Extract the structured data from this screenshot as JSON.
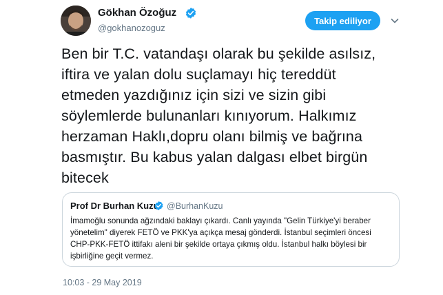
{
  "author": {
    "name": "Gökhan Özoğuz",
    "handle": "@gokhanozoguz",
    "verified": true
  },
  "follow_button": {
    "label": "Takip ediliyor"
  },
  "tweet": {
    "text": "Ben bir T.C. vatandaşı olarak bu şekilde asılsız,\niftira ve yalan dolu suçlamayı hiç tereddüt\netmeden yazdığınız için sizi ve sizin gibi\nsöylemlerde bulunanları kınıyorum. Halkımız\nherzaman Haklı,dopru olanı bilmiş ve bağrına\nbasmıştır. Bu kabus yalan dalgası elbet birgün\nbitecek",
    "timestamp": "10:03 - 29 May 2019"
  },
  "quoted_tweet": {
    "author_name": "Prof Dr Burhan Kuzu",
    "author_handle": "@BurhanKuzu",
    "verified": true,
    "text": "İmamoğlu sonunda ağzındaki baklayı çıkardı. Canlı yayında \"Gelin Türkiye'yi beraber\nyönetelim\" diyerek FETÖ ve PKK'ya açıkça mesaj gönderdi. İstanbul seçimleri öncesi\nCHP-PKK-FETÖ ittifakı aleni bir şekilde ortaya çıkmış oldu. İstanbul halkı böylesi bir\nişbirliğine geçit vermez."
  },
  "colors": {
    "accent": "#1da1f2",
    "text_primary": "#14171a",
    "text_secondary": "#657786",
    "border": "#ccd6dd"
  },
  "icons": [
    "verified-badge-icon",
    "chevron-down-icon"
  ]
}
